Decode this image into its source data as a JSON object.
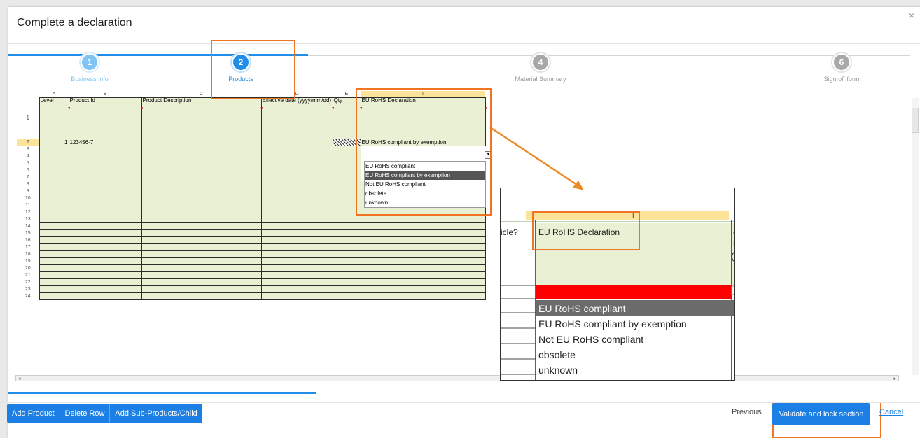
{
  "dialog": {
    "title": "Complete a declaration",
    "close_glyph": "×"
  },
  "steps": [
    {
      "number": "1",
      "label": "Business info",
      "state": "done"
    },
    {
      "number": "2",
      "label": "Products",
      "state": "active"
    },
    {
      "number": "4",
      "label": "Material Summary",
      "state": "pending"
    },
    {
      "number": "6",
      "label": "Sign off form",
      "state": "pending"
    }
  ],
  "sheet": {
    "columns": [
      "A",
      "B",
      "C",
      "D",
      "E",
      "I"
    ],
    "header_labels": [
      "Level",
      "Product Id",
      "Product Description",
      "Effective date (yyyy/mm/dd)",
      "Qty",
      "EU RoHS Declaration"
    ],
    "header_row_number": "1",
    "data_row": {
      "row": "2",
      "level": "1",
      "product_id": "123456-7",
      "declaration": "EU RoHS compliant by exemption"
    },
    "row_numbers": [
      "3",
      "4",
      "5",
      "6",
      "7",
      "8",
      "9",
      "10",
      "11",
      "12",
      "13",
      "14",
      "15",
      "16",
      "17",
      "18",
      "19",
      "20",
      "21",
      "22",
      "23",
      "24"
    ],
    "dropdown_options": [
      "EU RoHS compliant",
      "EU RoHS compliant by exemption",
      "Not EU RoHS compliant",
      "obsolete",
      "unknown"
    ],
    "dropdown_selected": "EU RoHS compliant by exemption"
  },
  "zoom": {
    "column_letter": "I",
    "left_fragment": "icle?",
    "header": "EU RoHS Declaration",
    "right_fragment_1": "Ch",
    "right_fragment_2": "De",
    "right_fragment_3": "C",
    "options": [
      "EU RoHS compliant",
      "EU RoHS compliant by exemption",
      "Not EU RoHS compliant",
      "obsolete",
      "unknown"
    ],
    "highlighted": "EU RoHS compliant"
  },
  "toolbar": {
    "add_product": "Add Product",
    "delete_row": "Delete Row",
    "add_sub_products": "Add Sub-Products/Child"
  },
  "footer": {
    "previous": "Previous",
    "validate": "Validate and lock section",
    "cancel": "Cancel"
  },
  "colors": {
    "accent": "#1c7fe6",
    "highlight": "#f07422",
    "cell_fill": "#eaf0d4",
    "invalid_cell": "#ff0000"
  }
}
